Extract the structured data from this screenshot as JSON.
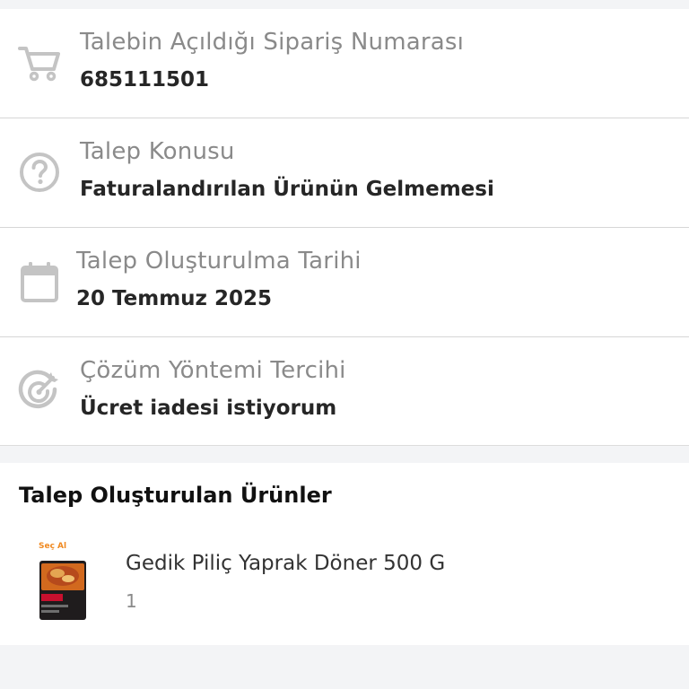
{
  "request_details": {
    "rows": [
      {
        "icon": "shopping-cart-icon",
        "label": "Talebin Açıldığı Sipariş Numarası",
        "value": "685111501"
      },
      {
        "icon": "question-circle-icon",
        "label": "Talep Konusu",
        "value": "Faturalandırılan Ürünün Gelmemesi"
      },
      {
        "icon": "calendar-icon",
        "label": "Talep Oluşturulma Tarihi",
        "value": "20 Temmuz 2025"
      },
      {
        "icon": "target-arrow-icon",
        "label": "Çözüm Yöntemi Tercihi",
        "value": "Ücret iadesi istiyorum"
      }
    ]
  },
  "products": {
    "title": "Talep Oluşturulan Ürünler",
    "items": [
      {
        "thumb_brand": "Seç Al",
        "name": "Gedik Piliç Yaprak Döner 500 G",
        "quantity": "1"
      }
    ]
  },
  "colors": {
    "background": "#f3f4f6",
    "card": "#ffffff",
    "label": "#8a8a8a",
    "value": "#262626",
    "icon": "#c4c4c4"
  }
}
